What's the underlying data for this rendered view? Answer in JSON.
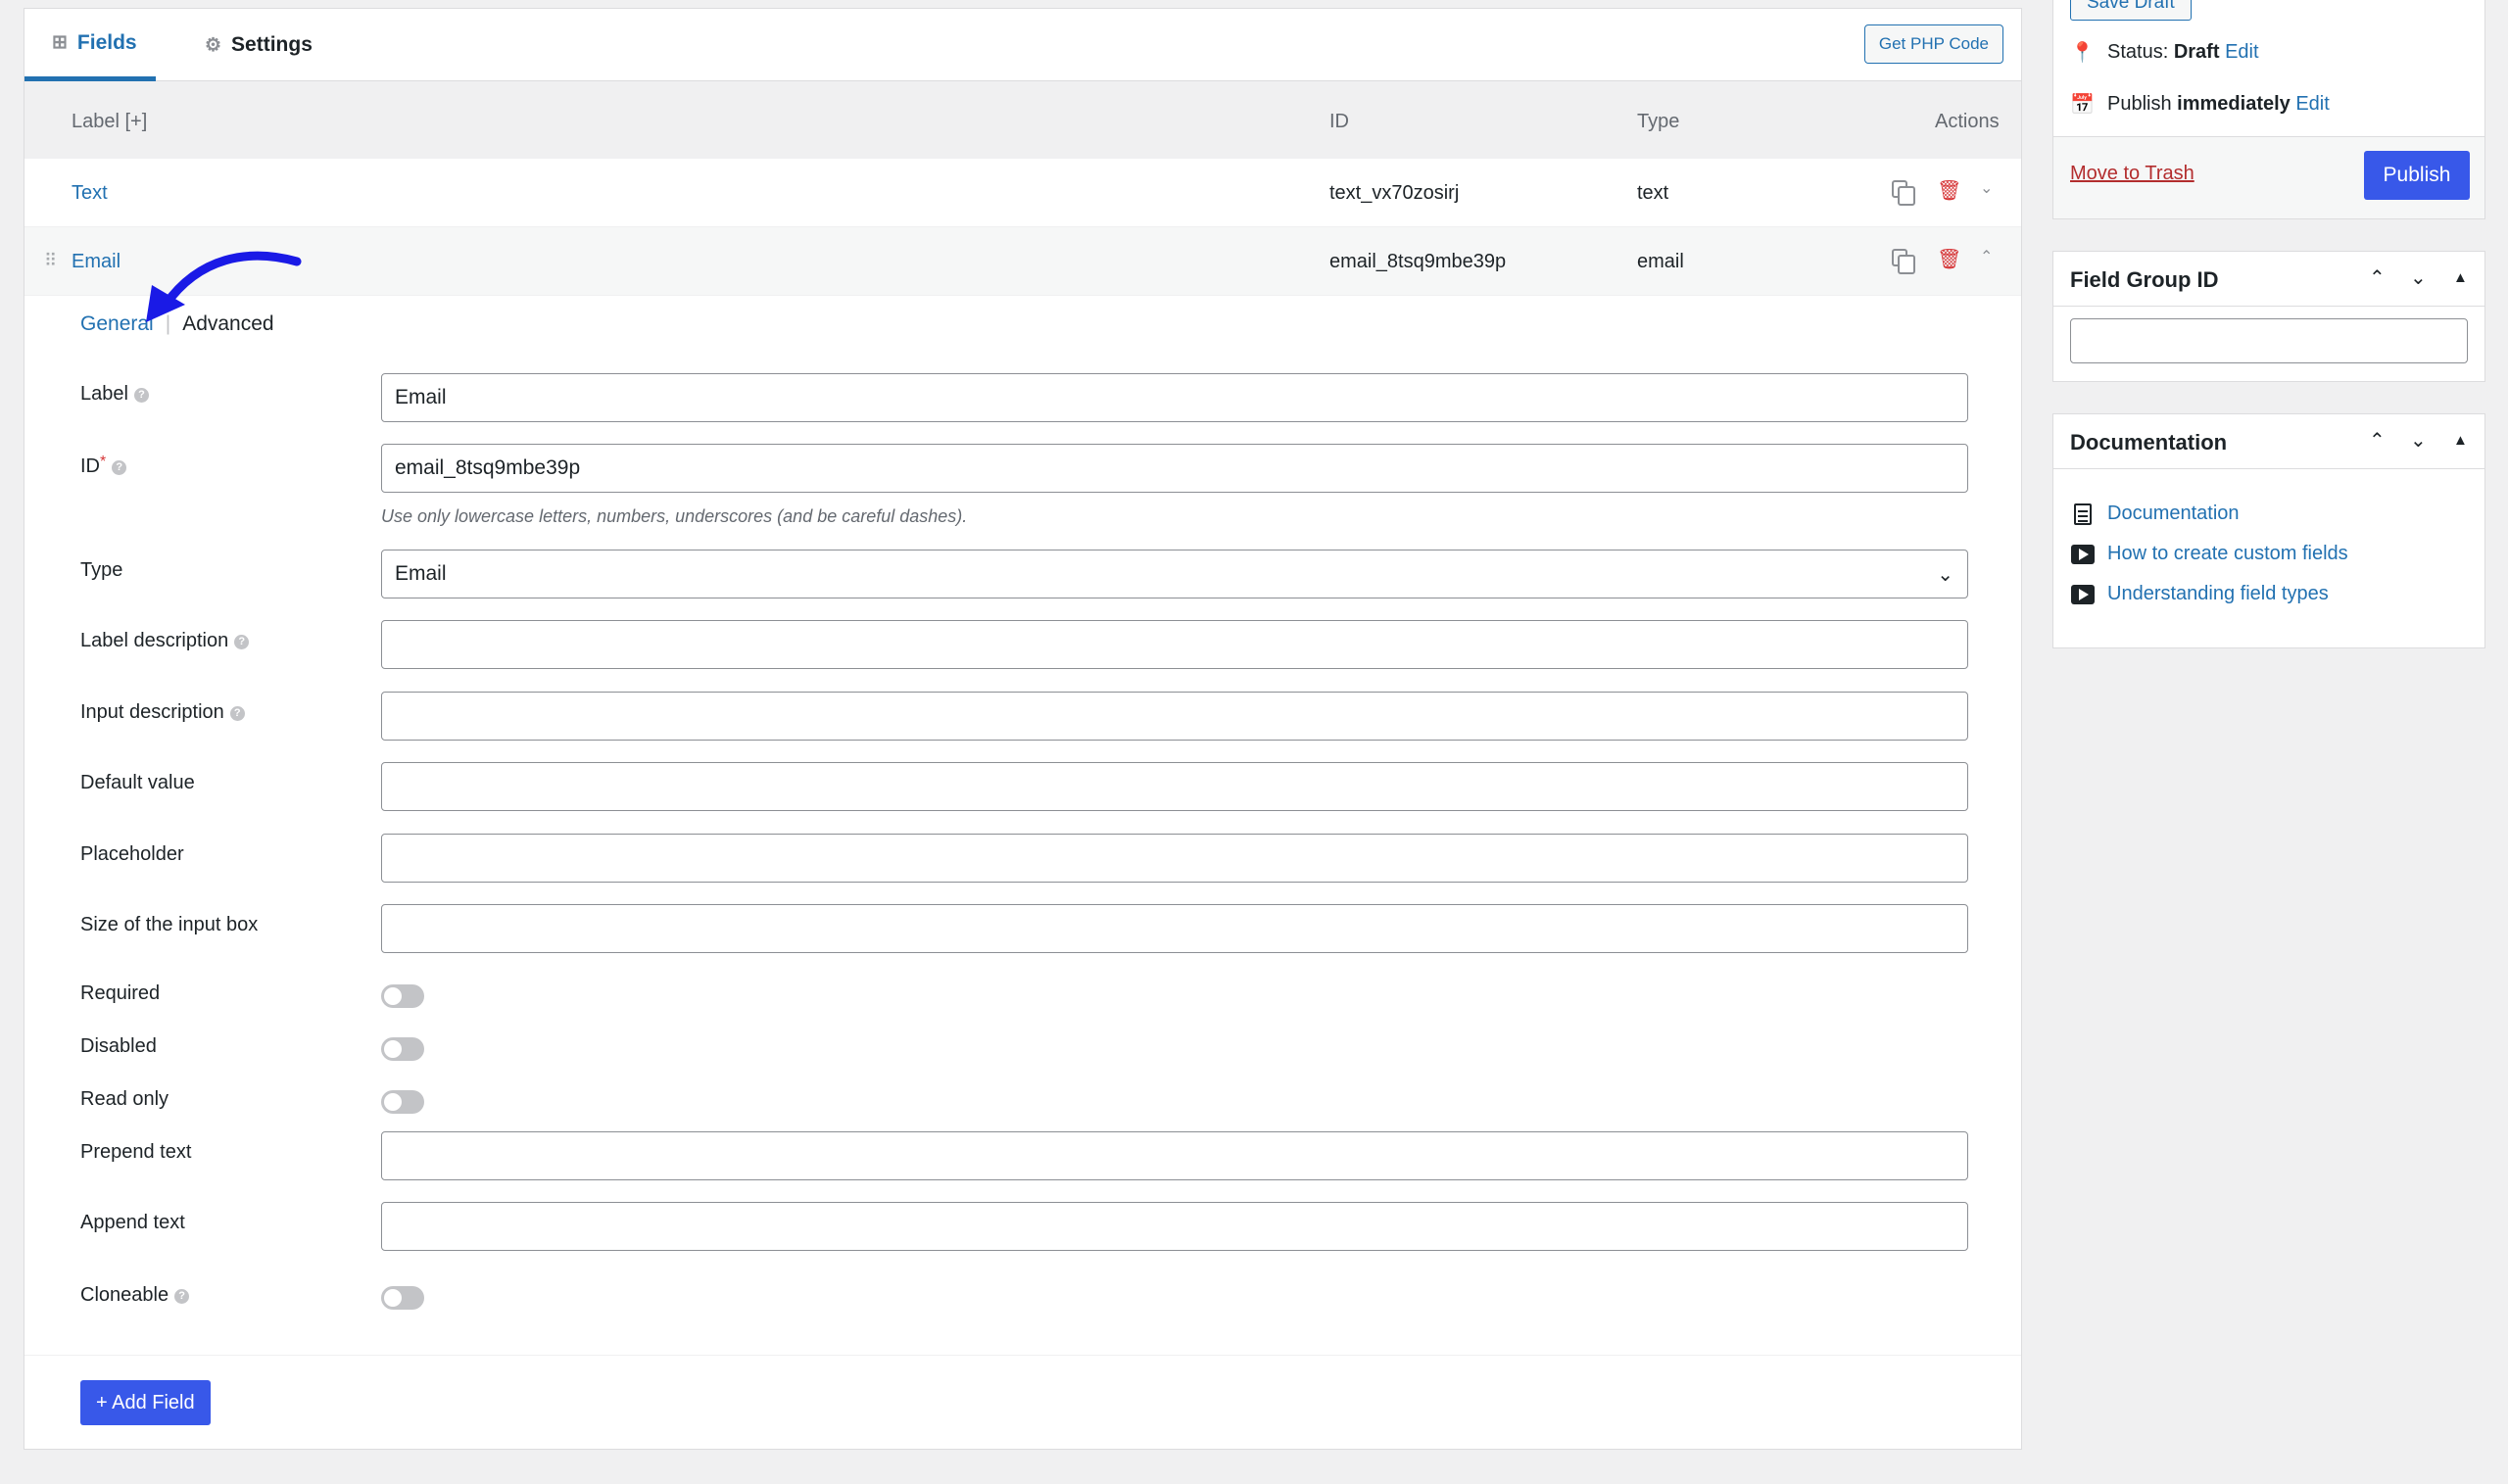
{
  "tabs": {
    "fields": "Fields",
    "settings": "Settings",
    "get_php_code": "Get PHP Code"
  },
  "table": {
    "headers": {
      "label": "Label [+]",
      "id": "ID",
      "type": "Type",
      "actions": "Actions"
    },
    "rows": [
      {
        "label": "Text",
        "id": "text_vx70zosirj",
        "type": "text"
      },
      {
        "label": "Email",
        "id": "email_8tsq9mbe39p",
        "type": "email"
      }
    ]
  },
  "field_editor": {
    "subtabs": {
      "general": "General",
      "advanced": "Advanced"
    },
    "label": {
      "label": "Label",
      "value": "Email"
    },
    "id": {
      "label": "ID",
      "required_mark": "*",
      "value": "email_8tsq9mbe39p",
      "hint": "Use only lowercase letters, numbers, underscores (and be careful dashes)."
    },
    "type": {
      "label": "Type",
      "value": "Email"
    },
    "label_description": {
      "label": "Label description"
    },
    "input_description": {
      "label": "Input description"
    },
    "default_value": {
      "label": "Default value"
    },
    "placeholder": {
      "label": "Placeholder"
    },
    "size": {
      "label": "Size of the input box"
    },
    "required": {
      "label": "Required"
    },
    "disabled": {
      "label": "Disabled"
    },
    "read_only": {
      "label": "Read only"
    },
    "prepend_text": {
      "label": "Prepend text"
    },
    "append_text": {
      "label": "Append text"
    },
    "cloneable": {
      "label": "Cloneable"
    },
    "help_glyph": "?"
  },
  "add_field_label": "+ Add Field",
  "publish": {
    "save_draft": "Save Draft",
    "status_label": "Status:",
    "status_value": "Draft",
    "status_edit": "Edit",
    "publish_label": "Publish",
    "publish_value": "immediately",
    "publish_edit": "Edit",
    "move_to_trash": "Move to Trash",
    "publish_button": "Publish"
  },
  "field_group_id": {
    "title": "Field Group ID",
    "value": ""
  },
  "documentation": {
    "title": "Documentation",
    "links": [
      {
        "icon": "document-icon",
        "label": "Documentation"
      },
      {
        "icon": "video-icon",
        "label": "How to create custom fields"
      },
      {
        "icon": "video-icon",
        "label": "Understanding field types"
      }
    ]
  },
  "colors": {
    "accent": "#2271b1",
    "primary_button": "#3858e9",
    "annotation_arrow": "#1a1ae6",
    "danger": "#d63638"
  },
  "toggles": {
    "required": false,
    "disabled": false,
    "read_only": false,
    "cloneable": false
  }
}
